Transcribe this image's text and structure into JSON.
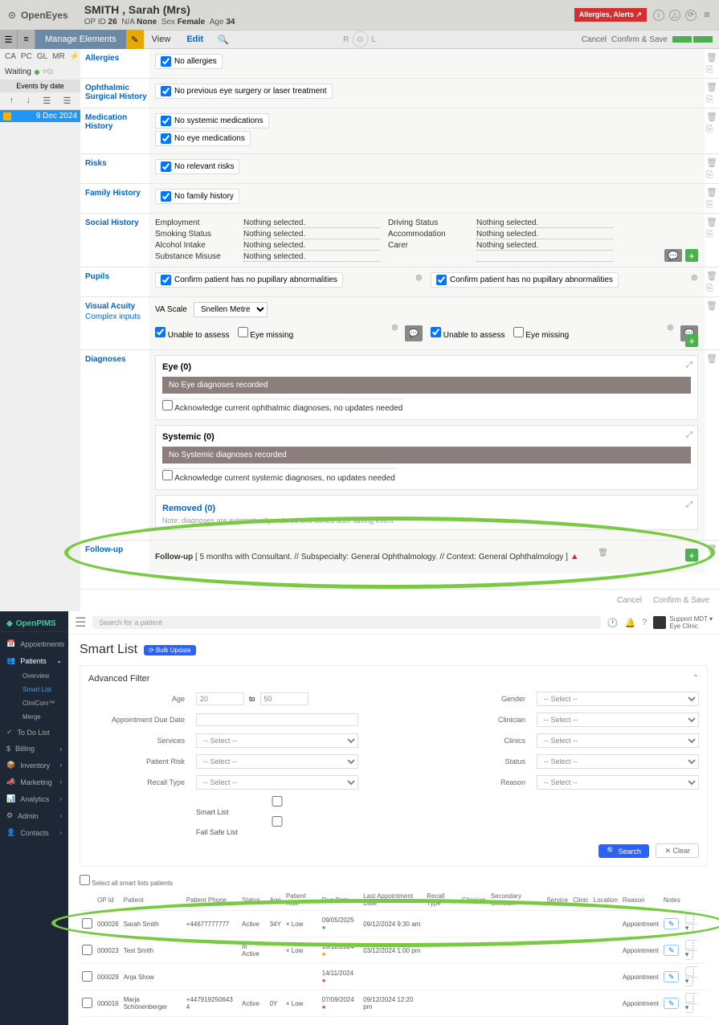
{
  "oe": {
    "logo": "OpenEyes",
    "patient": {
      "name": "SMITH , Sarah (Mrs)",
      "op_id_lbl": "OP ID",
      "op_id": "26",
      "na_lbl": "N/A",
      "na": "None",
      "sex_lbl": "Sex",
      "sex": "Female",
      "age_lbl": "Age",
      "age": "34"
    },
    "alert": "Allergies, Alerts ↗",
    "toolbar": {
      "manage": "Manage Elements",
      "view": "View",
      "edit": "Edit",
      "eye_l": "R",
      "eye_r": "L",
      "cancel": "Cancel",
      "confirm": "Confirm & Save"
    },
    "sidebar": {
      "tabs": [
        "CA",
        "PC",
        "GL",
        "MR"
      ],
      "waiting": "Waiting",
      "events_hdr": "Events by date",
      "event_date": "9 Dec 2024"
    },
    "sections": {
      "allergies": {
        "title": "Allergies",
        "pill": "No allergies"
      },
      "ophhist": {
        "title": "Ophthalmic Surgical History",
        "pill": "No previous eye surgery or laser treatment"
      },
      "medhist": {
        "title": "Medication History",
        "p1": "No systemic medications",
        "p2": "No eye medications"
      },
      "risks": {
        "title": "Risks",
        "pill": "No relevant risks"
      },
      "famhist": {
        "title": "Family History",
        "pill": "No family history"
      },
      "social": {
        "title": "Social History",
        "rows": [
          [
            "Employment",
            "Nothing selected.",
            "Driving Status",
            "Nothing selected."
          ],
          [
            "Smoking Status",
            "Nothing selected.",
            "Accommodation",
            "Nothing selected."
          ],
          [
            "Alcohol Intake",
            "Nothing selected.",
            "Carer",
            "Nothing selected."
          ],
          [
            "Substance Misuse",
            "Nothing selected.",
            "",
            ""
          ]
        ]
      },
      "pupils": {
        "title": "Pupils",
        "text": "Confirm patient has no pupillary abnormalities"
      },
      "va": {
        "title": "Visual Acuity",
        "link": "Complex inputs",
        "scale_lbl": "VA Scale",
        "scale": "Snellen Metre",
        "unable": "Unable to assess",
        "missing": "Eye missing"
      },
      "diag": {
        "title": "Diagnoses",
        "eye_t": "Eye (0)",
        "eye_bar": "No Eye diagnoses recorded",
        "eye_ack": "Acknowledge current ophthalmic diagnoses, no updates needed",
        "sys_t": "Systemic (0)",
        "sys_bar": "No Systemic diagnoses recorded",
        "sys_ack": "Acknowledge current systemic diagnoses, no updates needed",
        "removed": "Removed (0)",
        "note": "Note: diagnoses are automatically ordered and sorted after saving event"
      },
      "followup": {
        "title": "Follow-up",
        "lead": "Follow-up",
        "text": "[ 5 months with Consultant. // Subspecialty: General Ophthalmology. // Context: General Ophthalmology ]"
      }
    },
    "footer": {
      "cancel": "Cancel",
      "confirm": "Confirm & Save"
    }
  },
  "op": {
    "logo": "OpenPIMS",
    "nav": {
      "appointments": "Appointments",
      "patients": "Patients",
      "overview": "Overview",
      "smartlist": "Smart List",
      "clincom": "CliniCom™",
      "merge": "Merge",
      "todo": "To Do List",
      "billing": "Billing",
      "inventory": "Inventory",
      "marketing": "Marketing",
      "analytics": "Analytics",
      "admin": "Admin",
      "contacts": "Contacts"
    },
    "search_ph": "Search for a patient",
    "user": {
      "line1": "Support MDT ▾",
      "line2": "Eye Clinic"
    },
    "page_title": "Smart List",
    "bulk": "⟳ Bulk Update",
    "filter": {
      "title": "Advanced Filter",
      "age": "Age",
      "age_v1": "20",
      "to": "to",
      "age_v2": "50",
      "gender": "Gender",
      "appt_due": "Appointment Due Date",
      "clinician": "Clinician",
      "services": "Services",
      "clinics": "Clinics",
      "patient_risk": "Patient Risk",
      "status": "Status",
      "recall_type": "Recall Type",
      "reason": "Reason",
      "select": "-- Select --",
      "cb1": "Smart List",
      "cb2": "Fail Safe List",
      "search_btn": "Search",
      "clear_btn": "Clear"
    },
    "select_all": "Select all smart lists patients",
    "headers": [
      "",
      "OP Id",
      "Patient",
      "Patient Phone",
      "Status",
      "Age",
      "Patient Risk",
      "Due Date",
      "Last Appointment Date",
      "Recall Type",
      "Clinician",
      "Secondary Clinician",
      "Service",
      "Clinic",
      "Location",
      "Reason",
      "Notes",
      ""
    ],
    "rows": [
      {
        "id": "000026",
        "name": "Sarah Smith",
        "phone": "+44677777777",
        "status": "Active",
        "age": "34Y",
        "risk": "× Low",
        "due": "09/05/2025",
        "dclass": "dot-g",
        "last": "09/12/2024 9:30 am",
        "reason": "Appointment"
      },
      {
        "id": "000023",
        "name": "Test Smith",
        "phone": "",
        "status": "In Active",
        "age": "",
        "risk": "× Low",
        "due": "10/12/2024",
        "dclass": "dot-o",
        "last": "03/12/2024 1:00 pm",
        "reason": "Appointment"
      },
      {
        "id": "000029",
        "name": "Anja Show",
        "phone": "",
        "status": "",
        "age": "",
        "risk": "",
        "due": "14/11/2024",
        "dclass": "dot-r",
        "last": "",
        "reason": "Appointment"
      },
      {
        "id": "000016",
        "name": "Marja Schönenberger",
        "phone": "+447919250643 4",
        "status": "Active",
        "age": "0Y",
        "risk": "× Low",
        "due": "07/09/2024",
        "dclass": "dot-r",
        "last": "09/12/2024 12:20 pm",
        "reason": "Appointment"
      }
    ]
  }
}
